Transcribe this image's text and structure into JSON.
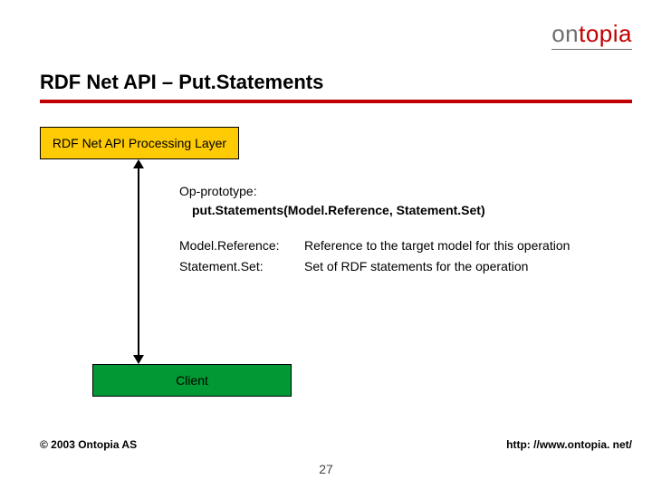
{
  "logo": {
    "part1": "on",
    "part2": "topia"
  },
  "title": "RDF Net API – Put.Statements",
  "box_api": "RDF Net API Processing Layer",
  "box_client": "Client",
  "proto_label": "Op-prototype:",
  "proto_sig": "put.Statements(Model.Reference, Statement.Set)",
  "params": {
    "p1_name": "Model.Reference:",
    "p1_desc": "Reference to the target model for this operation",
    "p2_name": "Statement.Set:",
    "p2_desc": "Set of RDF statements for the operation"
  },
  "copyright": "© 2003 Ontopia AS",
  "url": "http: //www.ontopia. net/",
  "pagenum": "27"
}
